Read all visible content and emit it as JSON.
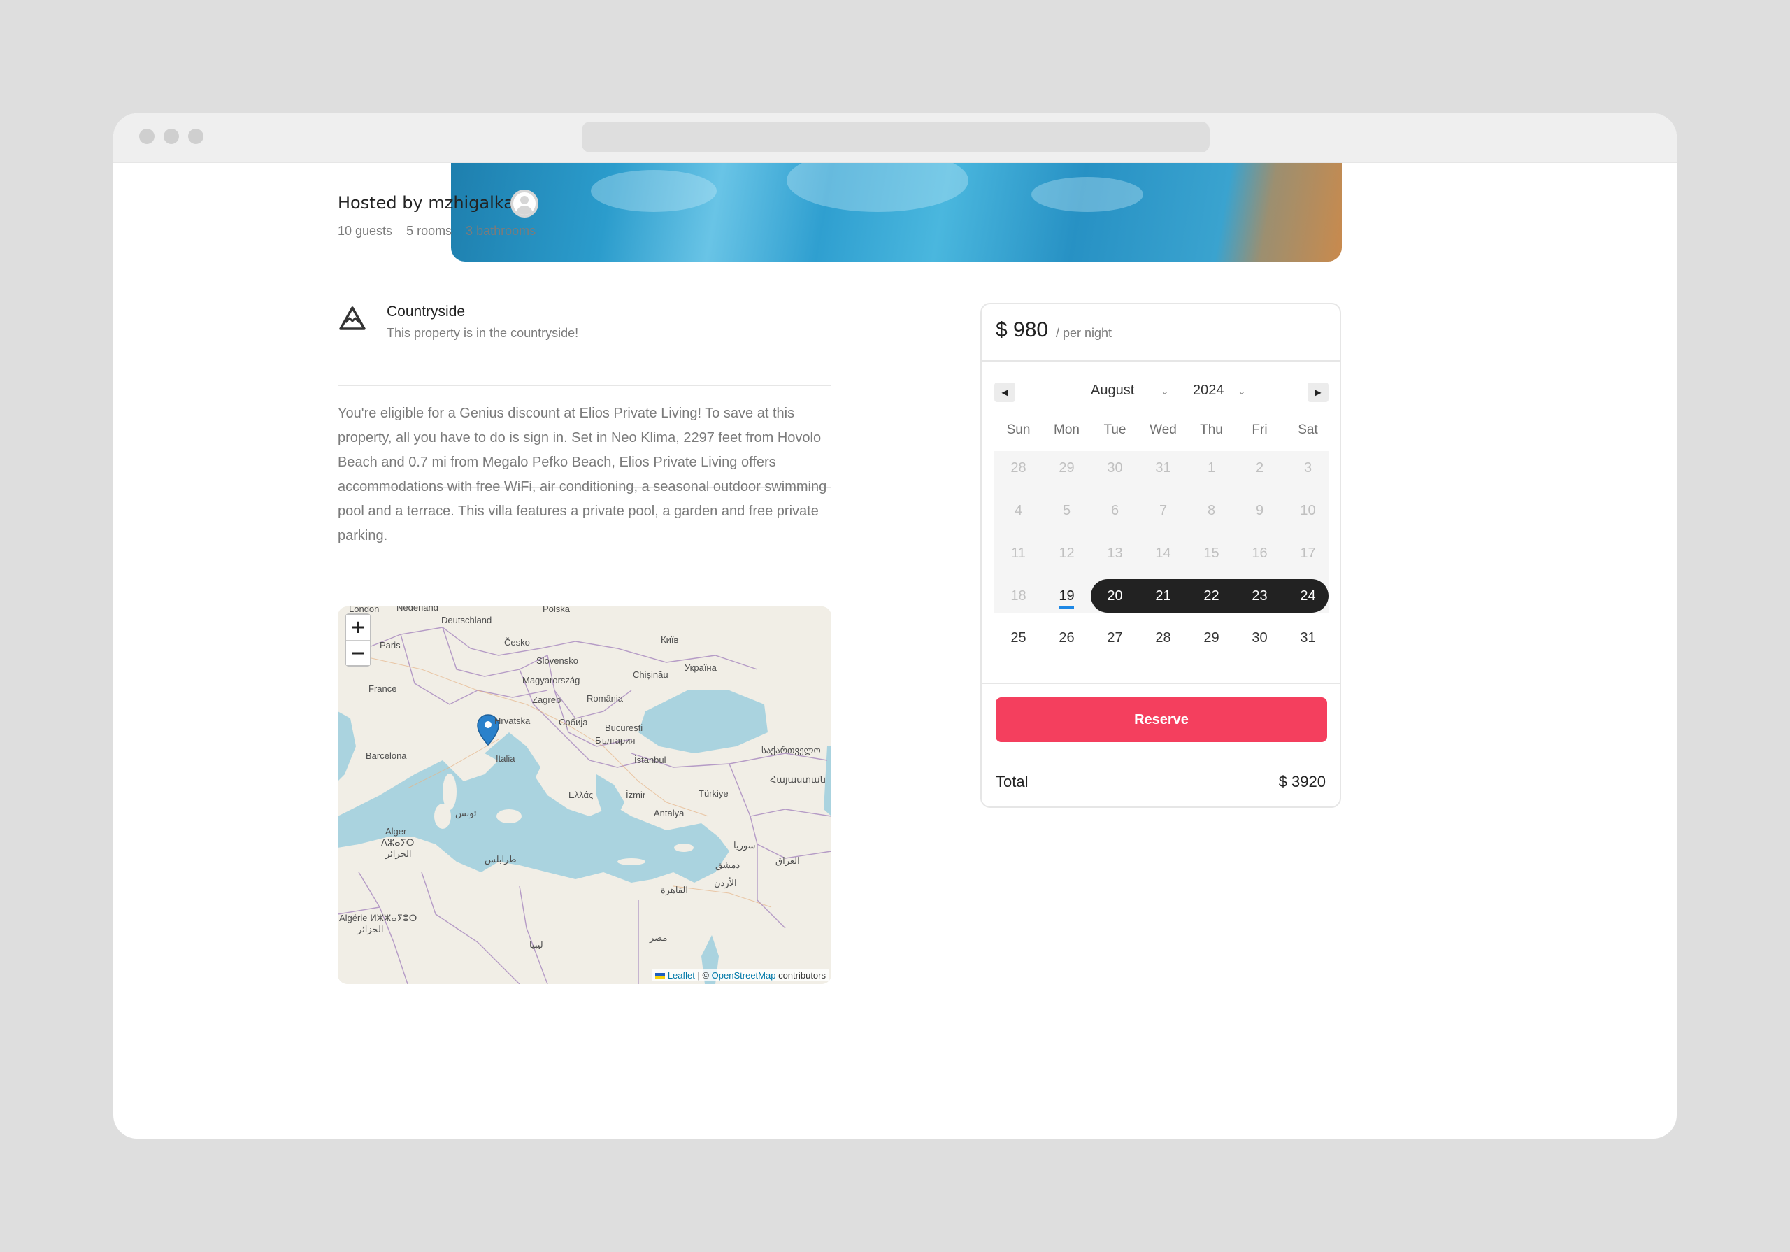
{
  "host": {
    "title": "Hosted by mzhigalka",
    "guests": "10 guests",
    "rooms": "5 rooms",
    "bathrooms": "3 bathrooms",
    "avatar_icon": "user-avatar-icon"
  },
  "category": {
    "icon": "mountain-icon",
    "title": "Countryside",
    "description": "This property is in the countryside!"
  },
  "description": "You're eligible for a Genius discount at Elios Private Living! To save at this property, all you have to do is sign in. Set in Neo Klima, 2297 feet from Hovolo Beach and 0.7 mi from Megalo Pefko Beach, Elios Private Living offers accommodations with free WiFi, air conditioning, a seasonal outdoor swimming pool and a terrace. This villa features a private pool, a garden and free private parking.",
  "map": {
    "zoom_in": "+",
    "zoom_out": "−",
    "attribution": {
      "leaflet": "Leaflet",
      "separator": " | © ",
      "osm": "OpenStreetMap",
      "suffix": " contributors"
    },
    "labels": {
      "london": "London",
      "nederland": "Nederland",
      "polska": "Polska",
      "deutschland": "Deutschland",
      "paris": "Paris",
      "cesko": "Česko",
      "kyiv": "Київ",
      "slovensko": "Slovensko",
      "ukraina": "Україна",
      "magyarorszag": "Magyarország",
      "chisinau": "Chișinău",
      "france": "France",
      "zagreb": "Zagreb",
      "romania": "România",
      "hrvatska": "Hrvatska",
      "srbija": "Србија",
      "bucuresti": "București",
      "bulgaria": "България",
      "barcelona": "Barcelona",
      "italia": "Italia",
      "istanbul": "İstanbul",
      "georgia": "საქართველო",
      "ellada": "Ελλάς",
      "izmir": "İzmir",
      "turkiye": "Türkiye",
      "armenia": "Հայաստան",
      "tunis": "تونس",
      "antalya": "Antalya",
      "alger": "Alger",
      "alger_ber": "ⴷⵣⴰⵢⵔ",
      "alger_ar": "الجزائر",
      "souria": "سوريا",
      "tarabulus": "طرابلس",
      "dimashq": "دمشق",
      "iraq": "العراق",
      "qahira": "القاهرة",
      "urdun": "الأردن",
      "algerie": "Algérie ⵍⵣⵣⴰⵢⴻⵔ",
      "jazair": "الجزائر",
      "libya": "ليبيا",
      "misr": "مصر"
    }
  },
  "booking": {
    "price": "$ 980",
    "per_night": "/ per night",
    "prev_icon": "caret-left-icon",
    "next_icon": "caret-right-icon",
    "month": "August",
    "year": "2024",
    "weekdays": [
      "Sun",
      "Mon",
      "Tue",
      "Wed",
      "Thu",
      "Fri",
      "Sat"
    ],
    "weeks": [
      [
        "28",
        "29",
        "30",
        "31",
        "1",
        "2",
        "3"
      ],
      [
        "4",
        "5",
        "6",
        "7",
        "8",
        "9",
        "10"
      ],
      [
        "11",
        "12",
        "13",
        "14",
        "15",
        "16",
        "17"
      ],
      [
        "18",
        "19",
        "20",
        "21",
        "22",
        "23",
        "24"
      ],
      [
        "25",
        "26",
        "27",
        "28",
        "29",
        "30",
        "31"
      ]
    ],
    "today": "19",
    "selected_range": [
      "20",
      "21",
      "22",
      "23",
      "24"
    ],
    "reserve_label": "Reserve",
    "total_label": "Total",
    "total_value": "$ 3920",
    "accent_color": "#f43f5e",
    "range_color": "#222222"
  }
}
